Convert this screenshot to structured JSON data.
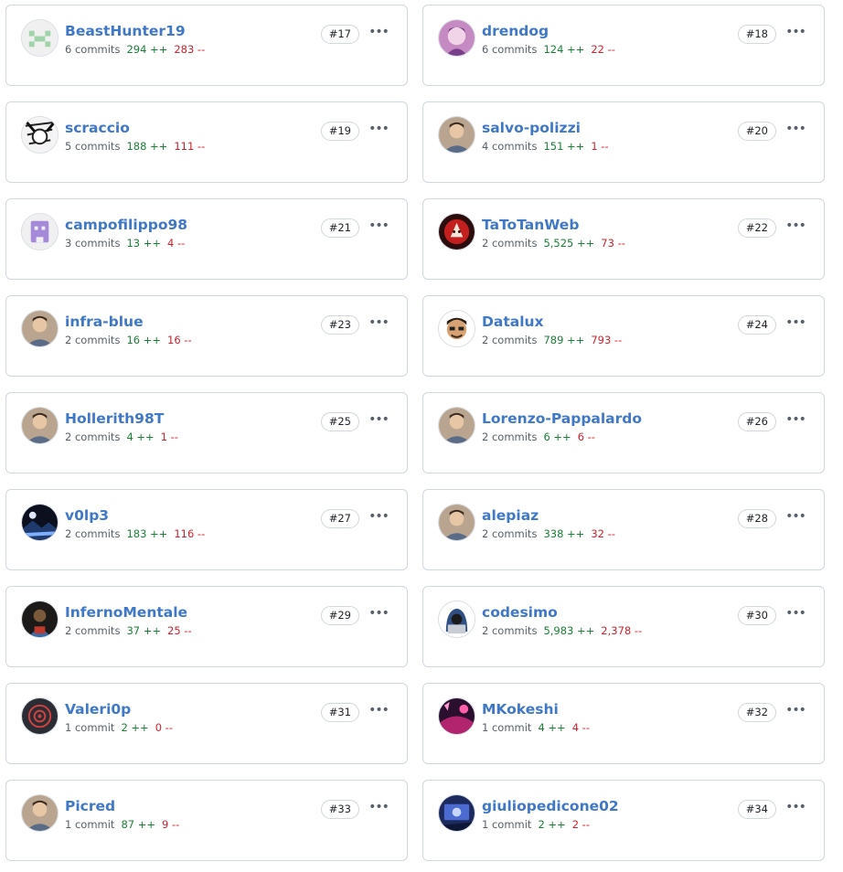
{
  "more_glyph": "•••",
  "contributors": [
    {
      "username": "BeastHunter19",
      "commits": "6 commits",
      "additions": "294 ++",
      "deletions": "283 --",
      "rank": "#17",
      "avatar": "identicon-green"
    },
    {
      "username": "drendog",
      "commits": "6 commits",
      "additions": "124 ++",
      "deletions": "22 --",
      "rank": "#18",
      "avatar": "anime-photo"
    },
    {
      "username": "scraccio",
      "commits": "5 commits",
      "additions": "188 ++",
      "deletions": "111 --",
      "rank": "#19",
      "avatar": "manga-sketch"
    },
    {
      "username": "salvo-polizzi",
      "commits": "4 commits",
      "additions": "151 ++",
      "deletions": "1 --",
      "rank": "#20",
      "avatar": "person-photo"
    },
    {
      "username": "campofilippo98",
      "commits": "3 commits",
      "additions": "13 ++",
      "deletions": "4 --",
      "rank": "#21",
      "avatar": "identicon-purple"
    },
    {
      "username": "TaToTanWeb",
      "commits": "2 commits",
      "additions": "5,525 ++",
      "deletions": "73 --",
      "rank": "#22",
      "avatar": "red-emblem"
    },
    {
      "username": "infra-blue",
      "commits": "2 commits",
      "additions": "16 ++",
      "deletions": "16 --",
      "rank": "#23",
      "avatar": "person-photo"
    },
    {
      "username": "Datalux",
      "commits": "2 commits",
      "additions": "789 ++",
      "deletions": "793 --",
      "rank": "#24",
      "avatar": "cartoon-face"
    },
    {
      "username": "Hollerith98T",
      "commits": "2 commits",
      "additions": "4 ++",
      "deletions": "1 --",
      "rank": "#25",
      "avatar": "person-photo"
    },
    {
      "username": "Lorenzo-Pappalardo",
      "commits": "2 commits",
      "additions": "6 ++",
      "deletions": "6 --",
      "rank": "#26",
      "avatar": "person-photo"
    },
    {
      "username": "v0lp3",
      "commits": "2 commits",
      "additions": "183 ++",
      "deletions": "116 --",
      "rank": "#27",
      "avatar": "dark-landscape"
    },
    {
      "username": "alepiaz",
      "commits": "2 commits",
      "additions": "338 ++",
      "deletions": "32 --",
      "rank": "#28",
      "avatar": "person-photo"
    },
    {
      "username": "InfernoMentale",
      "commits": "2 commits",
      "additions": "37 ++",
      "deletions": "25 --",
      "rank": "#29",
      "avatar": "dark-figure"
    },
    {
      "username": "codesimo",
      "commits": "2 commits",
      "additions": "5,983 ++",
      "deletions": "2,378 --",
      "rank": "#30",
      "avatar": "hooded-coder"
    },
    {
      "username": "Valeri0p",
      "commits": "1 commit",
      "additions": "2 ++",
      "deletions": "0 --",
      "rank": "#31",
      "avatar": "target-emblem"
    },
    {
      "username": "MKokeshi",
      "commits": "1 commit",
      "additions": "4 ++",
      "deletions": "4 --",
      "rank": "#32",
      "avatar": "neon-scene"
    },
    {
      "username": "Picred",
      "commits": "1 commit",
      "additions": "87 ++",
      "deletions": "9 --",
      "rank": "#33",
      "avatar": "person-photo"
    },
    {
      "username": "giuliopedicone02",
      "commits": "1 commit",
      "additions": "2 ++",
      "deletions": "2 --",
      "rank": "#34",
      "avatar": "blue-scene"
    }
  ]
}
